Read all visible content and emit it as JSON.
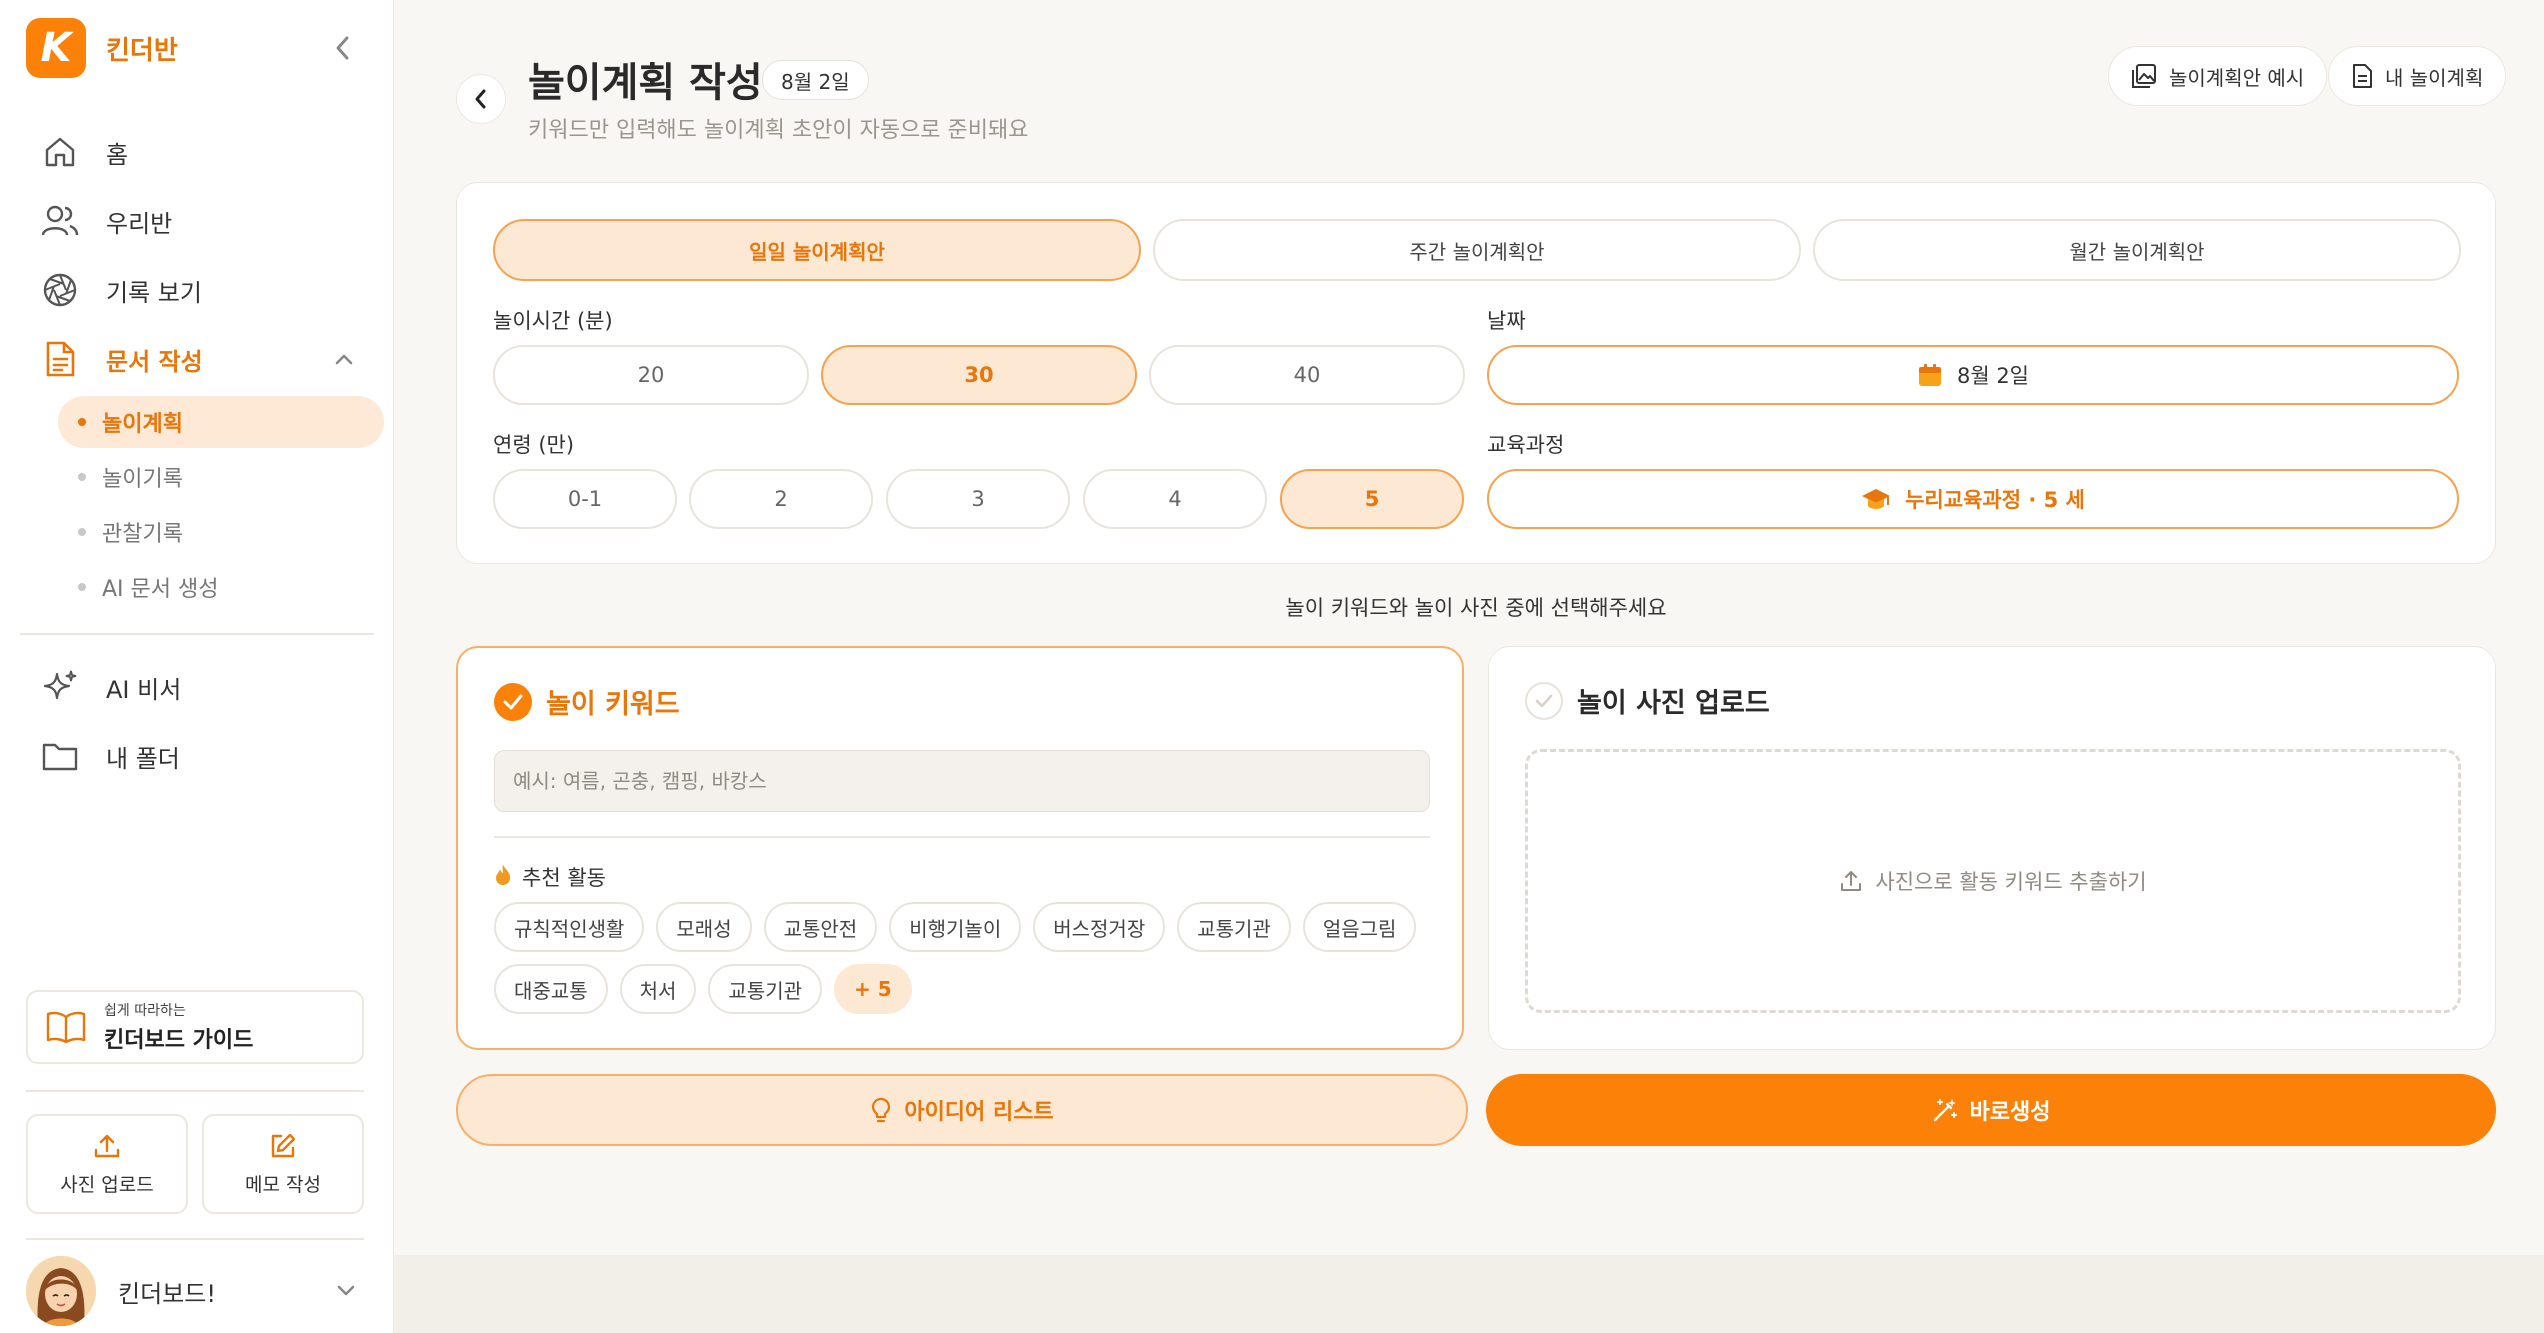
{
  "sidebar": {
    "brand": "킨더반",
    "nav": [
      {
        "label": "홈"
      },
      {
        "label": "우리반"
      },
      {
        "label": "기록 보기"
      },
      {
        "label": "문서 작성"
      }
    ],
    "subnav": [
      {
        "label": "놀이계획"
      },
      {
        "label": "놀이기록"
      },
      {
        "label": "관찰기록"
      },
      {
        "label": "AI 문서 생성"
      }
    ],
    "nav2": [
      {
        "label": "AI 비서"
      },
      {
        "label": "내 폴더"
      }
    ],
    "guide": {
      "small": "쉽게 따라하는",
      "big": "킨더보드 가이드"
    },
    "quick": {
      "upload": "사진 업로드",
      "memo": "메모 작성"
    },
    "profile": {
      "name": "킨더보드!"
    }
  },
  "header": {
    "title": "놀이계획 작성",
    "date_chip": "8월 2일",
    "subtitle": "키워드만 입력해도 놀이계획 초안이 자동으로 준비돼요",
    "example_btn": "놀이계획안 예시",
    "my_plans_btn": "내 놀이계획"
  },
  "plan_types": [
    "일일 놀이계획안",
    "주간 놀이계획안",
    "월간 놀이계획안"
  ],
  "selected_plan_type": "일일 놀이계획안",
  "duration": {
    "label": "놀이시간 (분)",
    "options": [
      "20",
      "30",
      "40"
    ],
    "selected": "30"
  },
  "date": {
    "label": "날짜",
    "value": "8월 2일"
  },
  "age": {
    "label": "연령 (만)",
    "options": [
      "0-1",
      "2",
      "3",
      "4",
      "5"
    ],
    "selected": "5"
  },
  "curriculum": {
    "label": "교육과정",
    "value": "누리교육과정 · 5 세"
  },
  "choose_hint": "놀이 키워드와 놀이 사진 중에 선택해주세요",
  "keyword_card": {
    "title": "놀이 키워드",
    "placeholder": "예시: 여름, 곤충, 캠핑, 바캉스",
    "value": "",
    "rec_title": "추천 활동",
    "chips_row1": [
      "규칙적인생활",
      "모래성",
      "교통안전",
      "비행기놀이",
      "버스정거장",
      "교통기관",
      "얼음그림"
    ],
    "chips_row2": [
      "대중교통",
      "처서",
      "교통기관"
    ],
    "more": "+ 5"
  },
  "photo_card": {
    "title": "놀이 사진 업로드",
    "upload_text": "사진으로 활동 키워드 추출하기"
  },
  "actions": {
    "ideas": "아이디어 리스트",
    "generate": "바로생성"
  },
  "colors": {
    "accent": "#fb8108",
    "accent_text": "#e8760a",
    "accent_soft": "#fde8d3",
    "background": "#f9f7f3"
  }
}
